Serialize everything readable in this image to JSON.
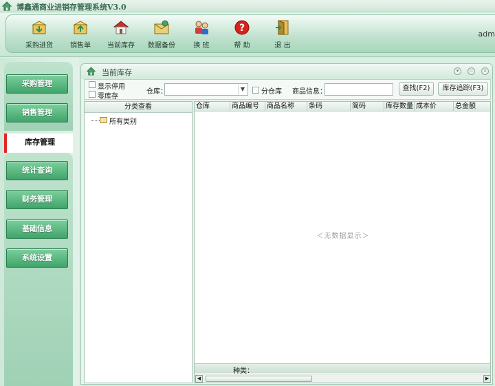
{
  "window": {
    "title": "博鑫通商业进销存管理系统V3.0"
  },
  "toolbar": {
    "buttons": [
      {
        "label": "采购进货",
        "icon": "purchase-box-icon"
      },
      {
        "label": "销售单",
        "icon": "sales-box-icon"
      },
      {
        "label": "当前库存",
        "icon": "warehouse-icon"
      },
      {
        "label": "数据备份",
        "icon": "backup-icon"
      },
      {
        "label": "换  班",
        "icon": "change-shift-icon"
      },
      {
        "label": "帮  助",
        "icon": "help-icon"
      },
      {
        "label": "退  出",
        "icon": "exit-icon"
      }
    ],
    "user": "adm"
  },
  "sidebar": {
    "items": [
      {
        "label": "采购管理"
      },
      {
        "label": "销售管理"
      },
      {
        "label": "库存管理",
        "active": true
      },
      {
        "label": "统计查询"
      },
      {
        "label": "财务管理"
      },
      {
        "label": "基础信息"
      },
      {
        "label": "系统设置"
      }
    ]
  },
  "panel": {
    "title": "当前库存",
    "filters": {
      "show_disabled_label": "显示停用",
      "zero_stock_label": "零库存",
      "warehouse_label": "仓库：",
      "warehouse_value": "",
      "split_warehouse_label": "分仓库",
      "product_info_label": "商品信息：",
      "product_info_value": "",
      "search_button": "查找(F2)",
      "trace_button": "库存追踪(F3)"
    },
    "category": {
      "header": "分类查看",
      "root_label": "所有类别"
    },
    "grid": {
      "columns": [
        "仓库",
        "商品编号",
        "商品名称",
        "条码",
        "简码",
        "库存数量",
        "成本价",
        "总金额"
      ],
      "empty_text": "＜无数据显示＞",
      "footer_label": "种类："
    }
  },
  "colors": {
    "accent_green": "#3fa46a",
    "active_marker": "#e0262c",
    "background": "#d9efe2"
  }
}
